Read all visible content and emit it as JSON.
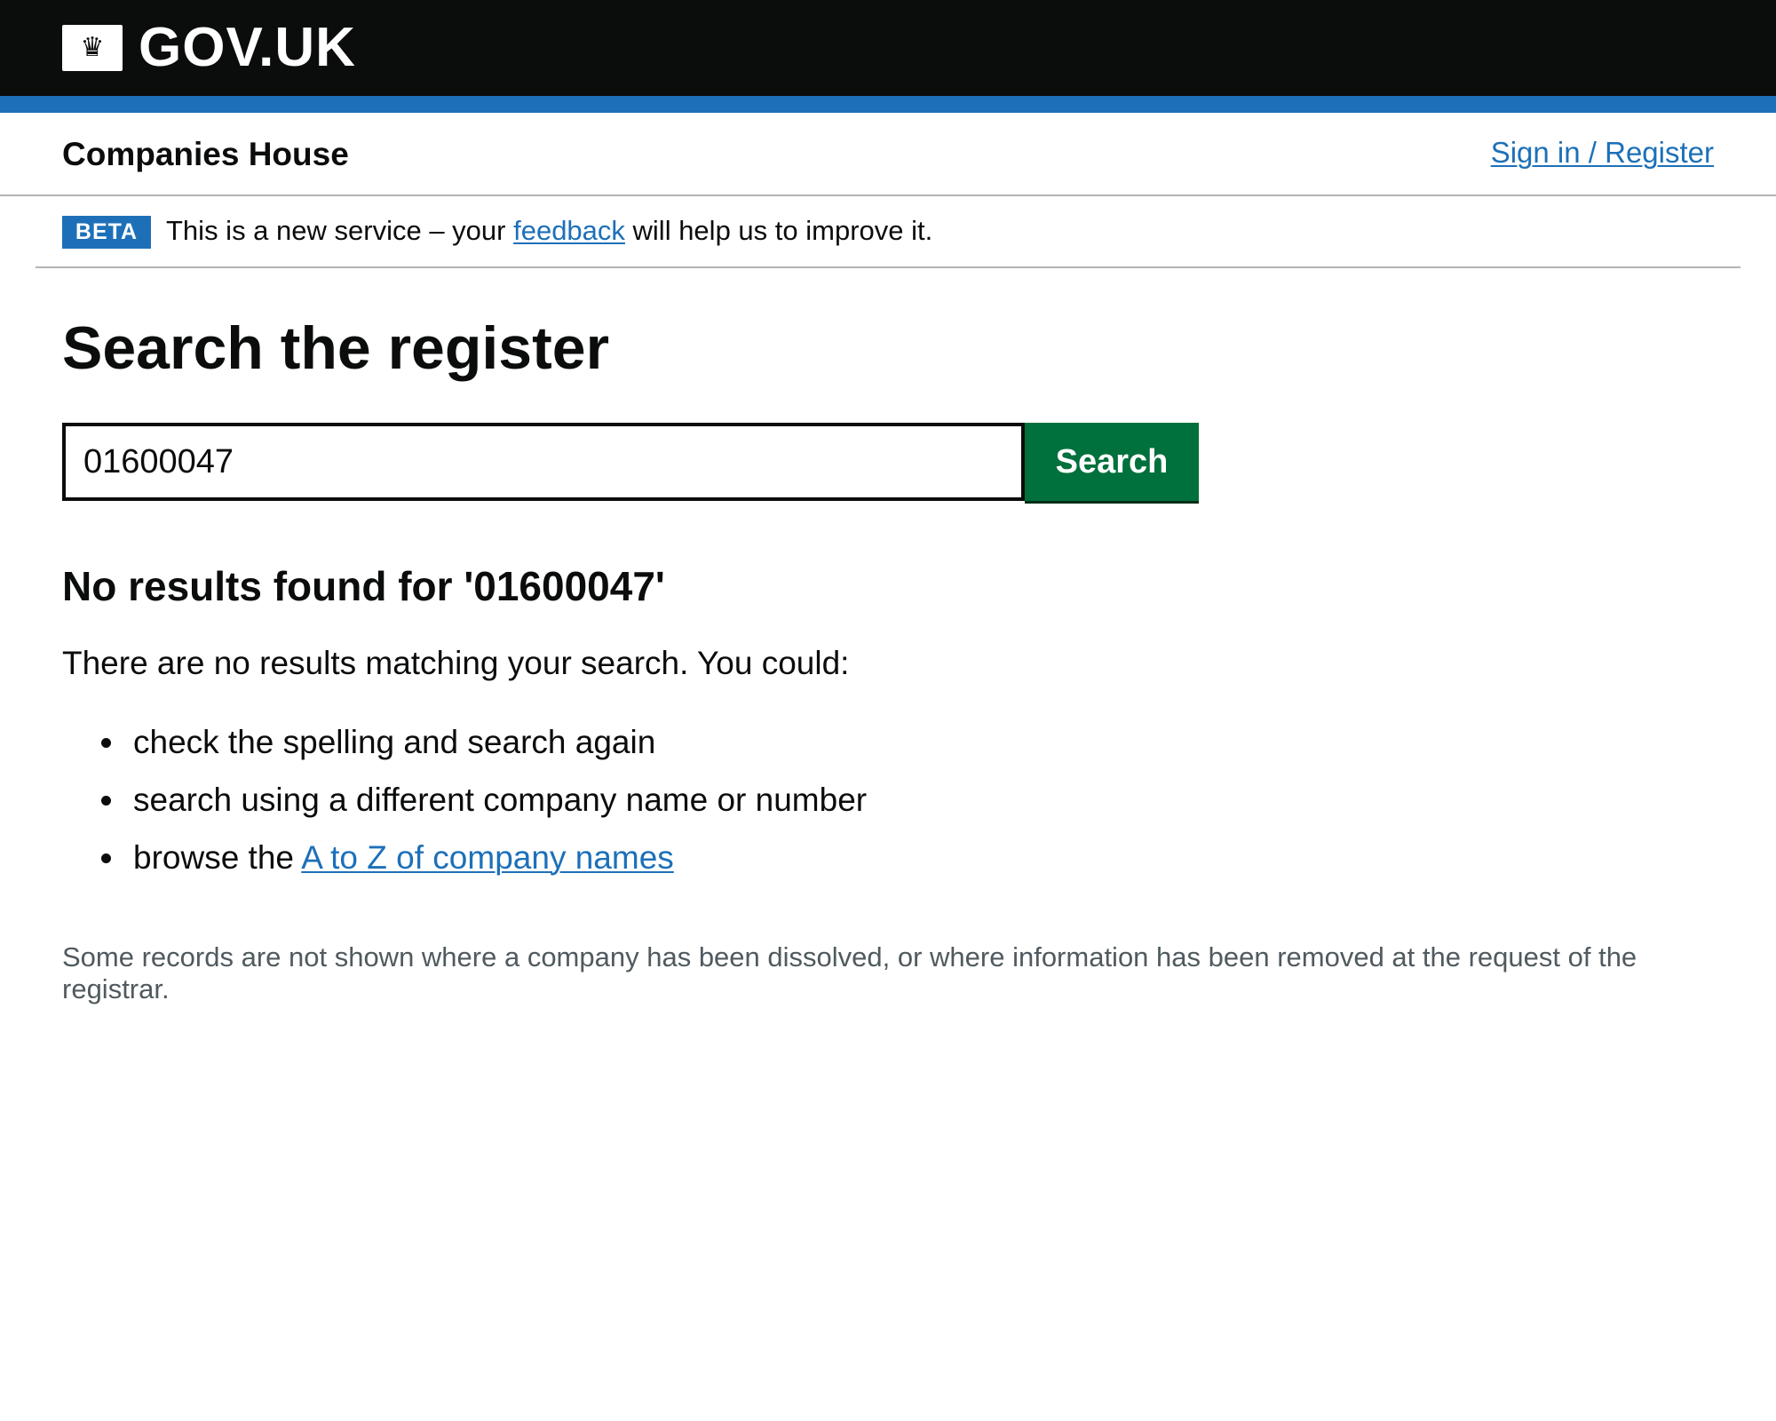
{
  "header": {
    "logo_icon": "crown-icon",
    "logo_glyph": "♛",
    "logo_text": "GOV.UK"
  },
  "service": {
    "name": "Companies House",
    "sign_in_label": "Sign in / Register"
  },
  "phase_banner": {
    "tag": "BETA",
    "text_before": "This is a new service – your ",
    "link_label": "feedback",
    "text_after": " will help us to improve it."
  },
  "page": {
    "title": "Search the register"
  },
  "search": {
    "value": "01600047",
    "button_label": "Search"
  },
  "results": {
    "heading": "No results found for '01600047'",
    "intro": "There are no results matching your search. You could:",
    "suggestions": [
      "check the spelling and search again",
      "search using a different company name or number"
    ],
    "browse_prefix": "browse the ",
    "browse_link_label": "A to Z of company names"
  },
  "footnote": "Some records are not shown where a company has been dissolved, or where information has been removed at the request of the registrar.",
  "colors": {
    "header_black": "#0b0c0c",
    "brand_blue": "#1d70b8",
    "button_green": "#00703c",
    "secondary_text": "#505a5f",
    "border_grey": "#b1b4b6"
  }
}
